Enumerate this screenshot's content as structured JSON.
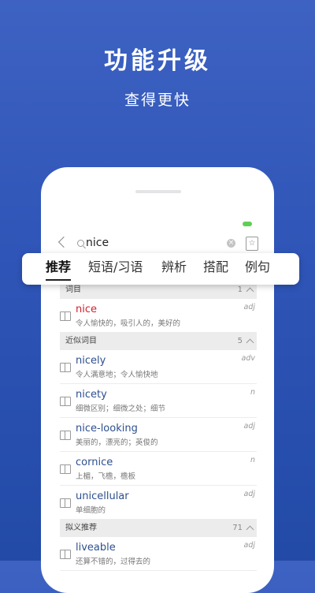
{
  "promo": {
    "title": "功能升级",
    "subtitle": "查得更快"
  },
  "search": {
    "value": "nice"
  },
  "tabs": [
    {
      "label": "推荐",
      "active": true
    },
    {
      "label": "短语/习语"
    },
    {
      "label": "辨析"
    },
    {
      "label": "搭配"
    },
    {
      "label": "例句"
    }
  ],
  "sections": [
    {
      "header": "词目",
      "count": "1",
      "entries": [
        {
          "word": "nice",
          "pos": "adj",
          "meaning": "令人愉快的，吸引人的，美好的"
        }
      ]
    },
    {
      "header": "近似词目",
      "count": "5",
      "entries": [
        {
          "word": "nicely",
          "pos": "adv",
          "meaning": "令人满意地；令人愉快地"
        },
        {
          "word": "nicety",
          "pos": "n",
          "meaning": "细微区别；细微之处；细节"
        },
        {
          "word": "nice-looking",
          "pos": "adj",
          "meaning": "美丽的，漂亮的；英俊的"
        },
        {
          "word": "cornice",
          "pos": "n",
          "meaning": "上楣，飞檐，檐板"
        },
        {
          "word": "unicellular",
          "pos": "adj",
          "meaning": "单细胞的"
        }
      ]
    },
    {
      "header": "拟义推荐",
      "count": "71",
      "entries": [
        {
          "word": "liveable",
          "pos": "adj",
          "meaning": "还算不错的，过得去的"
        }
      ]
    }
  ]
}
